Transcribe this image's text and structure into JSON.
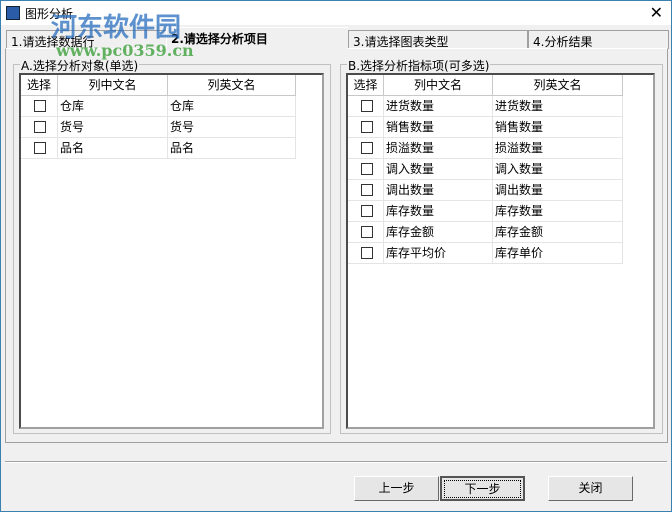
{
  "window": {
    "title": "图形分析",
    "close": "✕"
  },
  "watermark": {
    "name": "河东软件园",
    "url": "www.pc0359.cn"
  },
  "tabs": [
    {
      "label": "1.请选择数据行"
    },
    {
      "label": "2.请选择分析项目"
    },
    {
      "label": "3.请选择图表类型"
    },
    {
      "label": "4.分析结果"
    }
  ],
  "groupA": {
    "label": "A.选择分析对象(单选)",
    "headers": [
      "选择",
      "列中文名",
      "列英文名"
    ],
    "rows": [
      {
        "cn": "仓库",
        "en": "仓库",
        "checked": false
      },
      {
        "cn": "货号",
        "en": "货号",
        "checked": false
      },
      {
        "cn": "品名",
        "en": "品名",
        "checked": false
      }
    ]
  },
  "groupB": {
    "label": "B.选择分析指标项(可多选)",
    "headers": [
      "选择",
      "列中文名",
      "列英文名"
    ],
    "rows": [
      {
        "cn": "进货数量",
        "en": "进货数量",
        "checked": false
      },
      {
        "cn": "销售数量",
        "en": "销售数量",
        "checked": false
      },
      {
        "cn": "损溢数量",
        "en": "损溢数量",
        "checked": false
      },
      {
        "cn": "调入数量",
        "en": "调入数量",
        "checked": false
      },
      {
        "cn": "调出数量",
        "en": "调出数量",
        "checked": false
      },
      {
        "cn": "库存数量",
        "en": "库存数量",
        "checked": false
      },
      {
        "cn": "库存金额",
        "en": "库存金额",
        "checked": false
      },
      {
        "cn": "库存平均价",
        "en": "库存单价",
        "checked": false
      }
    ]
  },
  "buttons": {
    "prev": "上一步",
    "next": "下一步",
    "close": "关闭"
  }
}
